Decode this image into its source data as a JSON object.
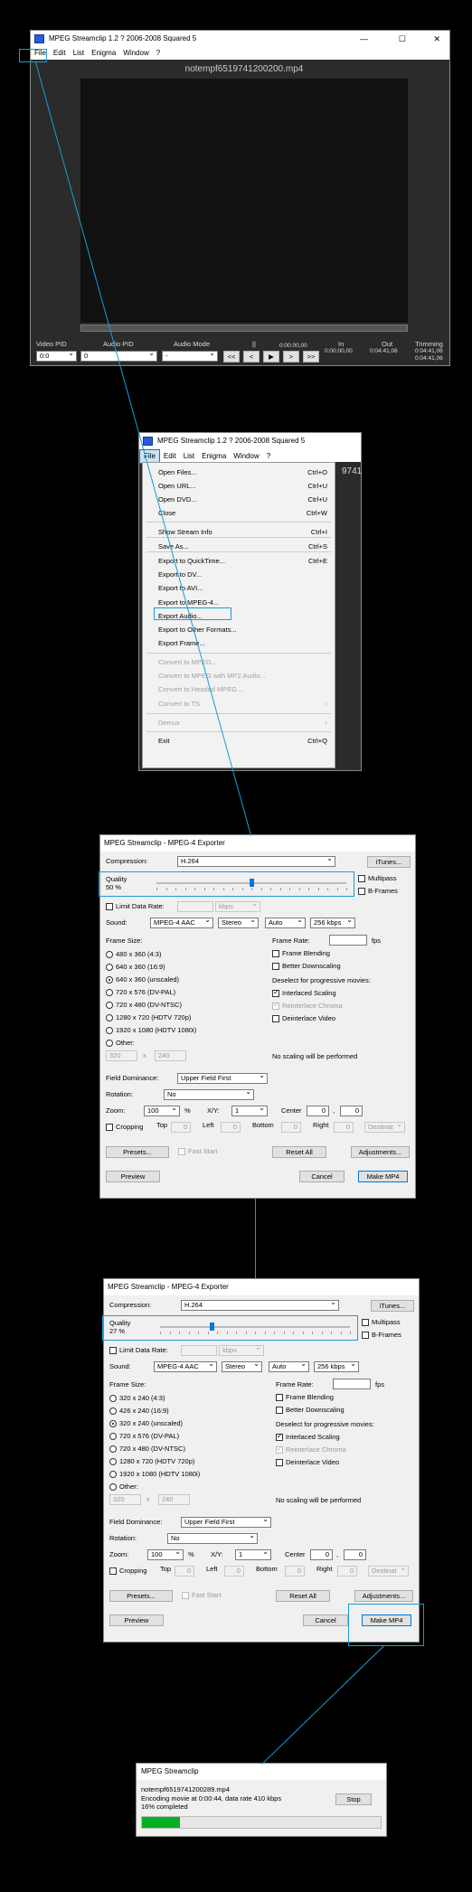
{
  "player": {
    "title": "MPEG Streamclip 1.2  ?  2006-2008 Squared 5",
    "window_controls": [
      "—",
      "☐",
      "✕"
    ],
    "menu": [
      "File",
      "Edit",
      "List",
      "Enigma",
      "Window",
      "?"
    ],
    "filename": "notempf6519741200200.mp4",
    "labels": {
      "video_pid": "Video PID",
      "audio_pid": "Audio PID",
      "audio_mode": "Audio Mode",
      "pause": "||",
      "time": "0:00:00,00",
      "in": "In",
      "in_value": "0:00:00,00",
      "out": "Out",
      "out_value": "0:04:41,06",
      "trimming": "Trimming",
      "trim_value": "0:04:41,06"
    },
    "values": {
      "video_pid": "0:0",
      "audio_pid": "0",
      "audio_mode": "-"
    },
    "transport": [
      "<<",
      "<",
      "▶",
      ">",
      ">>"
    ]
  },
  "file_menu": {
    "title": "MPEG Streamclip 1.2  ?  2006-2008 Squared 5",
    "menu": [
      "File",
      "Edit",
      "List",
      "Enigma",
      "Window",
      "?"
    ],
    "peek": "9741",
    "items": [
      {
        "label": "Open Files...",
        "shortcut": "Ctrl+O",
        "enabled": true
      },
      {
        "label": "Open URL...",
        "shortcut": "Ctrl+U",
        "enabled": true
      },
      {
        "label": "Open DVD...",
        "shortcut": "Ctrl+U",
        "enabled": true
      },
      {
        "label": "Close",
        "shortcut": "Ctrl+W",
        "enabled": true
      },
      {
        "label": "Show Stream Info",
        "shortcut": "Ctrl+I",
        "enabled": true
      },
      {
        "label": "Save As...",
        "shortcut": "Ctrl+S",
        "enabled": true
      },
      {
        "label": "Export to QuickTime...",
        "shortcut": "Ctrl+E",
        "enabled": true
      },
      {
        "label": "Export to DV...",
        "shortcut": "",
        "enabled": true
      },
      {
        "label": "Export to AVI...",
        "shortcut": "",
        "enabled": true
      },
      {
        "label": "Export to MPEG-4...",
        "shortcut": "",
        "enabled": true
      },
      {
        "label": "Export Audio...",
        "shortcut": "",
        "enabled": true
      },
      {
        "label": "Export to Other Formats...",
        "shortcut": "",
        "enabled": true
      },
      {
        "label": "Export Frame...",
        "shortcut": "",
        "enabled": true
      },
      {
        "label": "Convert to MPEG...",
        "shortcut": "",
        "enabled": false
      },
      {
        "label": "Convert to MPEG with MP2 Audio...",
        "shortcut": "",
        "enabled": false
      },
      {
        "label": "Convert to Headed MPEG...",
        "shortcut": "",
        "enabled": false
      },
      {
        "label": "Convert to TS",
        "shortcut": "›",
        "enabled": false
      },
      {
        "label": "Demux",
        "shortcut": "›",
        "enabled": false
      },
      {
        "label": "Exit",
        "shortcut": "Ctrl+Q",
        "enabled": true
      }
    ]
  },
  "exporter1": {
    "title": "MPEG Streamclip - MPEG-4 Exporter",
    "compression_label": "Compression:",
    "compression": "H.264",
    "itunes": "iTunes...",
    "quality_label": "Quality",
    "quality_value": "50 %",
    "quality_fraction": 0.5,
    "multipass": "Multipass",
    "bframes": "B-Frames",
    "limit_data_rate": "Limit Data Rate:",
    "kbps": "kbps",
    "sound_label": "Sound:",
    "sound": "MPEG-4 AAC",
    "channels": "Stereo",
    "rate": "Auto",
    "bitrate": "256 kbps",
    "frame_size": "Frame Size:",
    "sizes": [
      "480 x 360  (4:3)",
      "640 x 360  (16:9)",
      "640 x 360  (unscaled)",
      "720 x 576  (DV-PAL)",
      "720 x 480  (DV-NTSC)",
      "1280 x 720  (HDTV 720p)",
      "1920 x 1080  (HDTV 1080i)",
      "Other:"
    ],
    "other_w": "320",
    "other_x": "x",
    "other_h": "240",
    "frame_rate": "Frame Rate:",
    "fps": "fps",
    "frame_blending": "Frame Blending",
    "better_downscaling": "Better Downscaling",
    "deselect": "Deselect for progressive movies:",
    "interlaced": "Interlaced Scaling",
    "reinterlace": "Reinterlace Chroma",
    "deinterlace": "Deinterlace Video",
    "no_scaling": "No scaling will be performed",
    "field_dominance": "Field Dominance:",
    "field_value": "Upper Field First",
    "rotation": "Rotation:",
    "rotation_value": "No",
    "zoom": "Zoom:",
    "zoom_value": "100",
    "percent": "%",
    "xy": "X/Y:",
    "xy_value": "1",
    "center": "Center",
    "center_x": "0",
    "comma": ",",
    "center_y": "0",
    "cropping": "Cropping",
    "top": "Top",
    "top_v": "0",
    "left": "Left",
    "left_v": "0",
    "bottom": "Bottom",
    "bottom_v": "0",
    "right": "Right",
    "right_v": "0",
    "destination": "Destinat",
    "presets": "Presets...",
    "fast_start": "Fast Start",
    "reset_all": "Reset All",
    "adjustments": "Adjustments...",
    "preview": "Preview",
    "cancel": "Cancel",
    "make": "Make MP4"
  },
  "exporter2": {
    "title": "MPEG Streamclip - MPEG-4 Exporter",
    "compression_label": "Compression:",
    "compression": "H.264",
    "itunes": "iTunes...",
    "quality_label": "Quality",
    "quality_value": "27 %",
    "quality_fraction": 0.27,
    "multipass": "Multipass",
    "bframes": "B-Frames",
    "limit_data_rate": "Limit Data Rate:",
    "kbps": "kbps",
    "sound_label": "Sound:",
    "sound": "MPEG-4 AAC",
    "channels": "Stereo",
    "rate": "Auto",
    "bitrate": "256 kbps",
    "frame_size": "Frame Size:",
    "sizes": [
      "320 x 240  (4:3)",
      "426 x 240  (16:9)",
      "320 x 240  (unscaled)",
      "720 x 576  (DV-PAL)",
      "720 x 480  (DV-NTSC)",
      "1280 x 720  (HDTV 720p)",
      "1920 x 1080  (HDTV 1080i)",
      "Other:"
    ],
    "other_w": "320",
    "other_x": "x",
    "other_h": "240",
    "frame_rate": "Frame Rate:",
    "fps": "fps",
    "frame_blending": "Frame Blending",
    "better_downscaling": "Better Downscaling",
    "deselect": "Deselect for progressive movies:",
    "interlaced": "Interlaced Scaling",
    "reinterlace": "Reinterlace Chroma",
    "deinterlace": "Deinterlace Video",
    "no_scaling": "No scaling will be performed",
    "field_dominance": "Field Dominance:",
    "field_value": "Upper Field First",
    "rotation": "Rotation:",
    "rotation_value": "No",
    "zoom": "Zoom:",
    "zoom_value": "100",
    "percent": "%",
    "xy": "X/Y:",
    "xy_value": "1",
    "center": "Center",
    "center_x": "0",
    "comma": ",",
    "center_y": "0",
    "cropping": "Cropping",
    "top": "Top",
    "top_v": "0",
    "left": "Left",
    "left_v": "0",
    "bottom": "Bottom",
    "bottom_v": "0",
    "right": "Right",
    "right_v": "0",
    "destination": "Destinat",
    "presets": "Presets...",
    "fast_start": "Fast Start",
    "reset_all": "Reset All",
    "adjustments": "Adjustments...",
    "preview": "Preview",
    "cancel": "Cancel",
    "make": "Make MP4"
  },
  "progress": {
    "title": "MPEG Streamclip",
    "file": "notempf6519741200289.mp4",
    "status": "Encoding movie at 0:00:44, data rate 410 kbps",
    "completed": "16% completed",
    "fraction": 0.16,
    "stop": "Stop"
  },
  "colors": {
    "highlight": "#1a9bd8",
    "progress": "#06b025"
  }
}
